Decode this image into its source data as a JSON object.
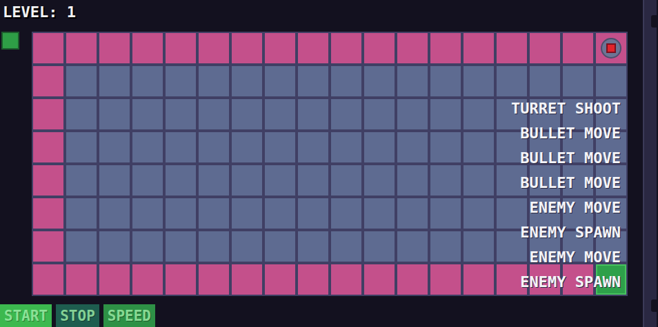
{
  "level": "LEVEL: 1",
  "grid": {
    "rows": [
      {
        "cells": [
          {
            "kind": "path"
          },
          {
            "kind": "path"
          },
          {
            "kind": "path"
          },
          {
            "kind": "path"
          },
          {
            "kind": "path"
          },
          {
            "kind": "path"
          },
          {
            "kind": "path"
          },
          {
            "kind": "path"
          },
          {
            "kind": "path"
          },
          {
            "kind": "path"
          },
          {
            "kind": "path"
          },
          {
            "kind": "path"
          },
          {
            "kind": "path"
          },
          {
            "kind": "path"
          },
          {
            "kind": "path"
          },
          {
            "kind": "path"
          },
          {
            "kind": "path"
          },
          {
            "kind": "turret"
          }
        ]
      },
      {
        "cells": [
          {
            "kind": "path"
          },
          {
            "kind": "floor"
          },
          {
            "kind": "floor"
          },
          {
            "kind": "floor"
          },
          {
            "kind": "floor"
          },
          {
            "kind": "floor"
          },
          {
            "kind": "floor"
          },
          {
            "kind": "floor"
          },
          {
            "kind": "floor"
          },
          {
            "kind": "floor"
          },
          {
            "kind": "floor"
          },
          {
            "kind": "floor"
          },
          {
            "kind": "floor"
          },
          {
            "kind": "floor"
          },
          {
            "kind": "floor"
          },
          {
            "kind": "floor"
          },
          {
            "kind": "floor"
          },
          {
            "kind": "floor"
          }
        ]
      },
      {
        "cells": [
          {
            "kind": "path"
          },
          {
            "kind": "floor"
          },
          {
            "kind": "floor"
          },
          {
            "kind": "floor"
          },
          {
            "kind": "floor"
          },
          {
            "kind": "floor"
          },
          {
            "kind": "floor"
          },
          {
            "kind": "floor"
          },
          {
            "kind": "floor"
          },
          {
            "kind": "floor"
          },
          {
            "kind": "floor"
          },
          {
            "kind": "floor"
          },
          {
            "kind": "floor"
          },
          {
            "kind": "floor"
          },
          {
            "kind": "floor"
          },
          {
            "kind": "floor"
          },
          {
            "kind": "floor"
          },
          {
            "kind": "floor"
          }
        ]
      },
      {
        "cells": [
          {
            "kind": "path"
          },
          {
            "kind": "floor"
          },
          {
            "kind": "floor"
          },
          {
            "kind": "floor"
          },
          {
            "kind": "floor"
          },
          {
            "kind": "floor"
          },
          {
            "kind": "floor"
          },
          {
            "kind": "floor"
          },
          {
            "kind": "floor"
          },
          {
            "kind": "floor"
          },
          {
            "kind": "floor"
          },
          {
            "kind": "floor"
          },
          {
            "kind": "floor"
          },
          {
            "kind": "floor"
          },
          {
            "kind": "floor"
          },
          {
            "kind": "floor"
          },
          {
            "kind": "floor"
          },
          {
            "kind": "floor"
          }
        ]
      },
      {
        "cells": [
          {
            "kind": "path"
          },
          {
            "kind": "floor"
          },
          {
            "kind": "floor"
          },
          {
            "kind": "floor"
          },
          {
            "kind": "floor"
          },
          {
            "kind": "floor"
          },
          {
            "kind": "floor"
          },
          {
            "kind": "floor"
          },
          {
            "kind": "floor"
          },
          {
            "kind": "floor"
          },
          {
            "kind": "floor"
          },
          {
            "kind": "floor"
          },
          {
            "kind": "floor"
          },
          {
            "kind": "floor"
          },
          {
            "kind": "floor"
          },
          {
            "kind": "floor"
          },
          {
            "kind": "floor"
          },
          {
            "kind": "floor"
          }
        ]
      },
      {
        "cells": [
          {
            "kind": "path"
          },
          {
            "kind": "floor"
          },
          {
            "kind": "floor"
          },
          {
            "kind": "floor"
          },
          {
            "kind": "floor"
          },
          {
            "kind": "floor"
          },
          {
            "kind": "floor"
          },
          {
            "kind": "floor"
          },
          {
            "kind": "floor"
          },
          {
            "kind": "floor"
          },
          {
            "kind": "floor"
          },
          {
            "kind": "floor"
          },
          {
            "kind": "floor"
          },
          {
            "kind": "floor"
          },
          {
            "kind": "floor"
          },
          {
            "kind": "floor"
          },
          {
            "kind": "floor"
          },
          {
            "kind": "floor"
          }
        ]
      },
      {
        "cells": [
          {
            "kind": "path"
          },
          {
            "kind": "floor"
          },
          {
            "kind": "floor"
          },
          {
            "kind": "floor"
          },
          {
            "kind": "floor"
          },
          {
            "kind": "floor"
          },
          {
            "kind": "floor"
          },
          {
            "kind": "floor"
          },
          {
            "kind": "floor"
          },
          {
            "kind": "floor"
          },
          {
            "kind": "floor"
          },
          {
            "kind": "floor"
          },
          {
            "kind": "floor"
          },
          {
            "kind": "floor"
          },
          {
            "kind": "floor"
          },
          {
            "kind": "floor"
          },
          {
            "kind": "floor"
          },
          {
            "kind": "floor"
          }
        ]
      },
      {
        "cells": [
          {
            "kind": "path"
          },
          {
            "kind": "path"
          },
          {
            "kind": "path"
          },
          {
            "kind": "path"
          },
          {
            "kind": "path"
          },
          {
            "kind": "path"
          },
          {
            "kind": "path"
          },
          {
            "kind": "path"
          },
          {
            "kind": "path"
          },
          {
            "kind": "path"
          },
          {
            "kind": "path"
          },
          {
            "kind": "path"
          },
          {
            "kind": "path"
          },
          {
            "kind": "path"
          },
          {
            "kind": "path"
          },
          {
            "kind": "path"
          },
          {
            "kind": "path"
          },
          {
            "kind": "goal"
          }
        ]
      }
    ]
  },
  "log": [
    "TURRET SHOOT",
    "BULLET MOVE",
    "BULLET MOVE",
    "BULLET MOVE",
    "ENEMY MOVE",
    "ENEMY SPAWN",
    "ENEMY MOVE",
    "ENEMY SPAWN"
  ],
  "buttons": [
    {
      "label": "START",
      "color": "#3cb94f"
    },
    {
      "label": "STOP",
      "color": "#1e5d4f"
    },
    {
      "label": "SPEED",
      "color": "#2e9146"
    }
  ]
}
